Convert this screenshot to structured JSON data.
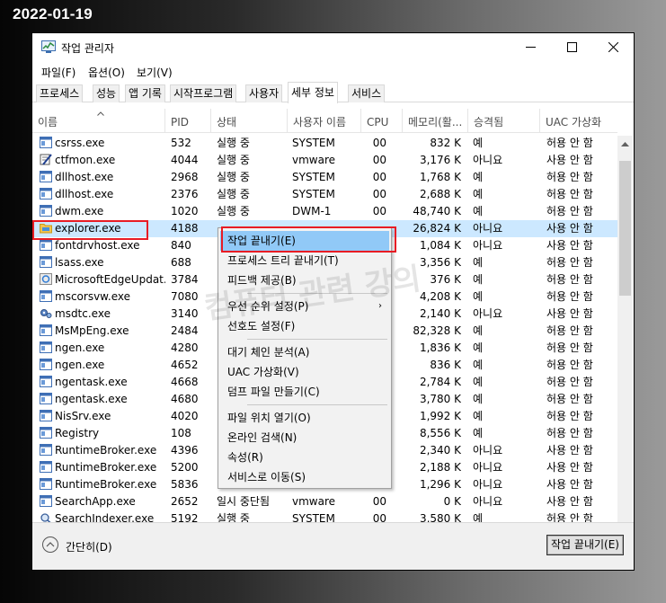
{
  "stamp": "2022-01-19",
  "window": {
    "title": "작업 관리자",
    "menu": [
      "파일(F)",
      "옵션(O)",
      "보기(V)"
    ],
    "tabs": [
      {
        "label": "프로세스",
        "active": false
      },
      {
        "label": "성능",
        "active": false
      },
      {
        "label": "앱 기록",
        "active": false
      },
      {
        "label": "시작프로그램",
        "active": false
      },
      {
        "label": "사용자",
        "active": false
      },
      {
        "label": "세부 정보",
        "active": true
      },
      {
        "label": "서비스",
        "active": false
      }
    ]
  },
  "columns": {
    "name": "이름",
    "pid": "PID",
    "status": "상태",
    "user": "사용자 이름",
    "cpu": "CPU",
    "memory": "메모리(활...",
    "comment": "승격됨",
    "uac": "UAC 가상화"
  },
  "rows": [
    {
      "name": "csrss.exe",
      "pid": "532",
      "status": "실행 중",
      "user": "SYSTEM",
      "cpu": "00",
      "mem": "832 K",
      "elevated": "예",
      "uac": "허용 안 함",
      "icon": "window-icon"
    },
    {
      "name": "ctfmon.exe",
      "pid": "4044",
      "status": "실행 중",
      "user": "vmware",
      "cpu": "00",
      "mem": "3,176 K",
      "elevated": "아니요",
      "uac": "사용 안 함",
      "icon": "notepad-pen-icon"
    },
    {
      "name": "dllhost.exe",
      "pid": "2968",
      "status": "실행 중",
      "user": "SYSTEM",
      "cpu": "00",
      "mem": "1,768 K",
      "elevated": "예",
      "uac": "허용 안 함",
      "icon": "window-icon"
    },
    {
      "name": "dllhost.exe",
      "pid": "2376",
      "status": "실행 중",
      "user": "SYSTEM",
      "cpu": "00",
      "mem": "2,688 K",
      "elevated": "예",
      "uac": "허용 안 함",
      "icon": "window-icon"
    },
    {
      "name": "dwm.exe",
      "pid": "1020",
      "status": "실행 중",
      "user": "DWM-1",
      "cpu": "00",
      "mem": "48,740 K",
      "elevated": "예",
      "uac": "허용 안 함",
      "icon": "window-icon"
    },
    {
      "name": "explorer.exe",
      "pid": "4188",
      "status": "",
      "user": "",
      "cpu": "",
      "mem": "26,824 K",
      "elevated": "아니요",
      "uac": "사용 안 함",
      "icon": "folder-icon"
    },
    {
      "name": "fontdrvhost.exe",
      "pid": "840",
      "status": "",
      "user": "",
      "cpu": "",
      "mem": "1,084 K",
      "elevated": "아니요",
      "uac": "사용 안 함",
      "icon": "window-icon"
    },
    {
      "name": "lsass.exe",
      "pid": "688",
      "status": "",
      "user": "",
      "cpu": "",
      "mem": "3,356 K",
      "elevated": "예",
      "uac": "허용 안 함",
      "icon": "window-icon"
    },
    {
      "name": "MicrosoftEdgeUpdat...",
      "pid": "3784",
      "status": "",
      "user": "",
      "cpu": "",
      "mem": "376 K",
      "elevated": "예",
      "uac": "허용 안 함",
      "icon": "edge-update-icon"
    },
    {
      "name": "mscorsvw.exe",
      "pid": "7080",
      "status": "",
      "user": "",
      "cpu": "",
      "mem": "4,208 K",
      "elevated": "예",
      "uac": "허용 안 함",
      "icon": "window-icon"
    },
    {
      "name": "msdtc.exe",
      "pid": "3140",
      "status": "",
      "user": "",
      "cpu": "",
      "mem": "2,140 K",
      "elevated": "아니요",
      "uac": "사용 안 함",
      "icon": "gear-network-icon"
    },
    {
      "name": "MsMpEng.exe",
      "pid": "2484",
      "status": "",
      "user": "",
      "cpu": "",
      "mem": "82,328 K",
      "elevated": "예",
      "uac": "허용 안 함",
      "icon": "window-icon"
    },
    {
      "name": "ngen.exe",
      "pid": "4280",
      "status": "",
      "user": "",
      "cpu": "",
      "mem": "1,836 K",
      "elevated": "예",
      "uac": "허용 안 함",
      "icon": "window-icon"
    },
    {
      "name": "ngen.exe",
      "pid": "4652",
      "status": "",
      "user": "",
      "cpu": "",
      "mem": "836 K",
      "elevated": "예",
      "uac": "허용 안 함",
      "icon": "window-icon"
    },
    {
      "name": "ngentask.exe",
      "pid": "4668",
      "status": "",
      "user": "",
      "cpu": "",
      "mem": "2,784 K",
      "elevated": "예",
      "uac": "허용 안 함",
      "icon": "window-icon"
    },
    {
      "name": "ngentask.exe",
      "pid": "4680",
      "status": "",
      "user": "",
      "cpu": "",
      "mem": "3,780 K",
      "elevated": "예",
      "uac": "허용 안 함",
      "icon": "window-icon"
    },
    {
      "name": "NisSrv.exe",
      "pid": "4020",
      "status": "",
      "user": "",
      "cpu": "",
      "mem": "1,992 K",
      "elevated": "예",
      "uac": "허용 안 함",
      "icon": "window-icon"
    },
    {
      "name": "Registry",
      "pid": "108",
      "status": "",
      "user": "",
      "cpu": "",
      "mem": "8,556 K",
      "elevated": "예",
      "uac": "허용 안 함",
      "icon": "window-icon"
    },
    {
      "name": "RuntimeBroker.exe",
      "pid": "4396",
      "status": "",
      "user": "",
      "cpu": "",
      "mem": "2,340 K",
      "elevated": "아니요",
      "uac": "사용 안 함",
      "icon": "window-icon"
    },
    {
      "name": "RuntimeBroker.exe",
      "pid": "5200",
      "status": "",
      "user": "",
      "cpu": "",
      "mem": "2,188 K",
      "elevated": "아니요",
      "uac": "사용 안 함",
      "icon": "window-icon"
    },
    {
      "name": "RuntimeBroker.exe",
      "pid": "5836",
      "status": "",
      "user": "",
      "cpu": "",
      "mem": "1,296 K",
      "elevated": "아니요",
      "uac": "사용 안 함",
      "icon": "window-icon"
    },
    {
      "name": "SearchApp.exe",
      "pid": "2652",
      "status": "일시 중단됨",
      "user": "vmware",
      "cpu": "00",
      "mem": "0 K",
      "elevated": "아니요",
      "uac": "사용 안 함",
      "icon": "window-icon"
    },
    {
      "name": "SearchIndexer.exe",
      "pid": "5192",
      "status": "실행 중",
      "user": "SYSTEM",
      "cpu": "00",
      "mem": "3,580 K",
      "elevated": "예",
      "uac": "허용 안 함",
      "icon": "search-indexer-icon"
    }
  ],
  "context_menu": {
    "items": [
      {
        "label": "작업 끝내기(E)",
        "hover": true
      },
      {
        "label": "프로세스 트리 끝내기(T)"
      },
      {
        "label": "피드백 제공(B)"
      },
      {
        "separator": true
      },
      {
        "label": "우선 순위 설정(P)",
        "submenu": true
      },
      {
        "label": "선호도 설정(F)"
      },
      {
        "separator": true
      },
      {
        "label": "대기 체인 분석(A)"
      },
      {
        "label": "UAC 가상화(V)"
      },
      {
        "label": "덤프 파일 만들기(C)"
      },
      {
        "separator": true
      },
      {
        "label": "파일 위치 열기(O)"
      },
      {
        "label": "온라인 검색(N)"
      },
      {
        "label": "속성(R)"
      },
      {
        "label": "서비스로 이동(S)"
      }
    ]
  },
  "watermark": "컴퓨터 관련 강의",
  "footer": {
    "fewer_details": "간단히(D)",
    "end_task": "작업 끝내기(E)"
  },
  "colors": {
    "selection": "#cce8ff",
    "menu_hover": "#91c9f7",
    "highlight_border": "#e81c24"
  }
}
